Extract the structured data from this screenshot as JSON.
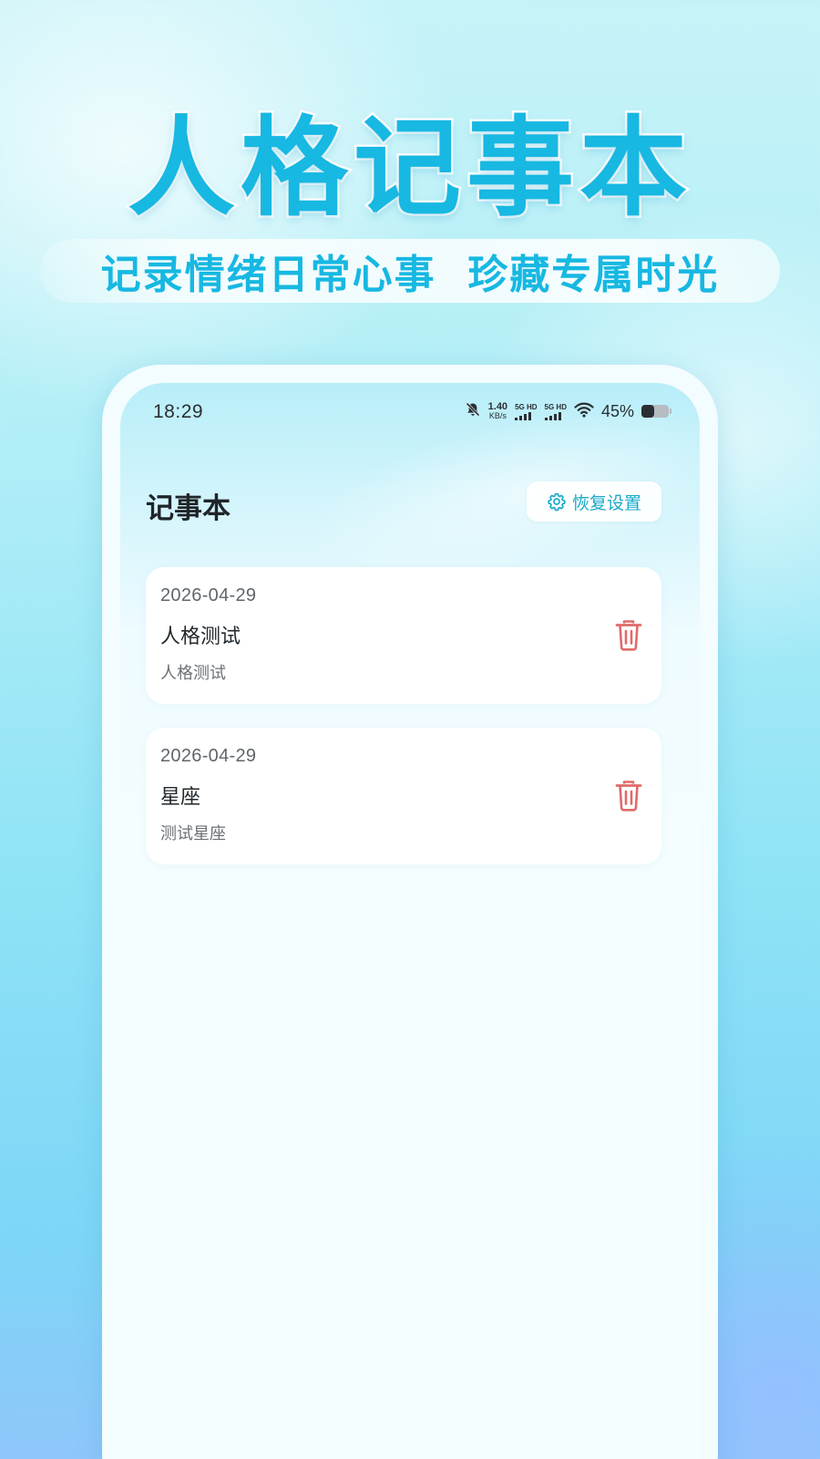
{
  "promo": {
    "title": "人格记事本",
    "subtitle": "记录情绪日常心事  珍藏专属时光"
  },
  "status_bar": {
    "time": "18:29",
    "net_speed_value": "1.40",
    "net_speed_unit": "KB/s",
    "sim1_label": "5G HD",
    "sim2_label": "5G HD",
    "battery_text": "45%",
    "battery_level": 0.45,
    "icons": [
      "bell-muted-icon",
      "signal-icon",
      "wifi-icon",
      "battery-icon"
    ]
  },
  "header": {
    "title": "记事本",
    "restore_label": "恢复设置",
    "restore_icon": "gear-icon"
  },
  "notes": [
    {
      "date": "2026-04-29",
      "title": "人格测试",
      "body": "人格测试"
    },
    {
      "date": "2026-04-29",
      "title": "星座",
      "body": "测试星座"
    }
  ],
  "colors": {
    "accent": "#17b8e2",
    "delete": "#e06a6a",
    "restore_text": "#19a9c9"
  }
}
